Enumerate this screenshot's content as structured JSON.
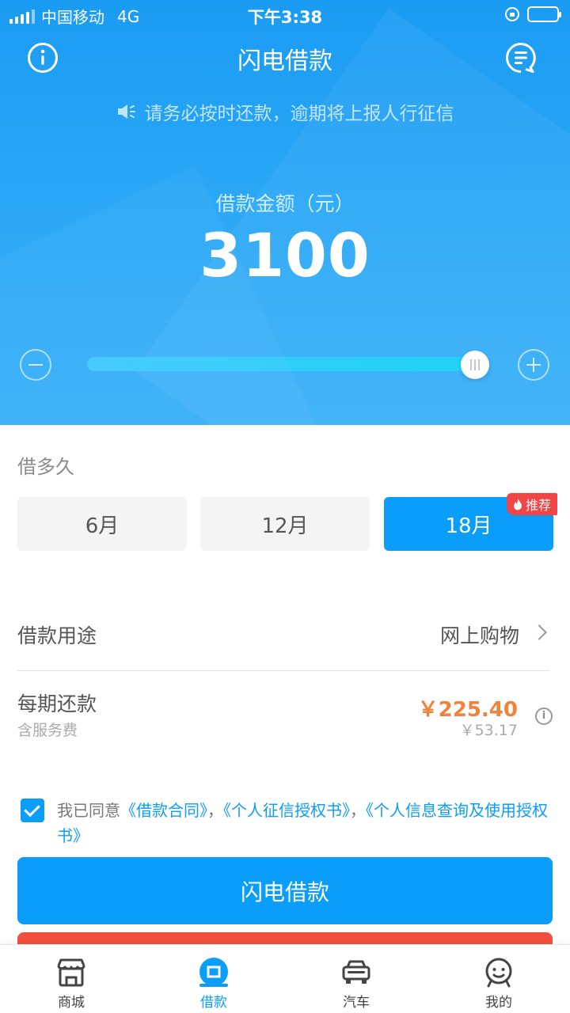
{
  "status_bar": {
    "carrier": "中国移动",
    "network": "4G",
    "time": "下午3:38"
  },
  "header": {
    "title": "闪电借款",
    "left_icon": "info-icon",
    "right_icon": "message-icon"
  },
  "notice": {
    "icon": "speaker-icon",
    "text": "请务必按时还款，逾期将上报人行征信"
  },
  "amount": {
    "label": "借款金额（元）",
    "value": "3100",
    "slider_fraction": 0.97
  },
  "duration": {
    "label": "借多久",
    "options": [
      "6月",
      "12月",
      "18月"
    ],
    "selected": "18月",
    "tag": "推荐"
  },
  "purpose": {
    "label": "借款用途",
    "value": "网上购物"
  },
  "payment": {
    "label": "每期还款",
    "sub": "含服务费",
    "amount": "￥225.40",
    "fee": "￥53.17"
  },
  "agreement": {
    "prefix": "我已同意",
    "link1": "《借款合同》",
    "sep1": "，",
    "link2": "《个人征信授权书》",
    "sep2": "，",
    "link3": "《个人信息查询及使用授权书》",
    "checked": true
  },
  "submit_label": "闪电借款",
  "tabbar": {
    "items": [
      {
        "label": "商城",
        "icon": "shop-icon"
      },
      {
        "label": "借款",
        "icon": "loan-icon"
      },
      {
        "label": "汽车",
        "icon": "car-icon"
      },
      {
        "label": "我的",
        "icon": "profile-icon"
      }
    ],
    "active": "借款"
  },
  "colors": {
    "primary": "#0b9dfa",
    "accent_orange": "#f0833b",
    "tag_red": "#f04545"
  }
}
